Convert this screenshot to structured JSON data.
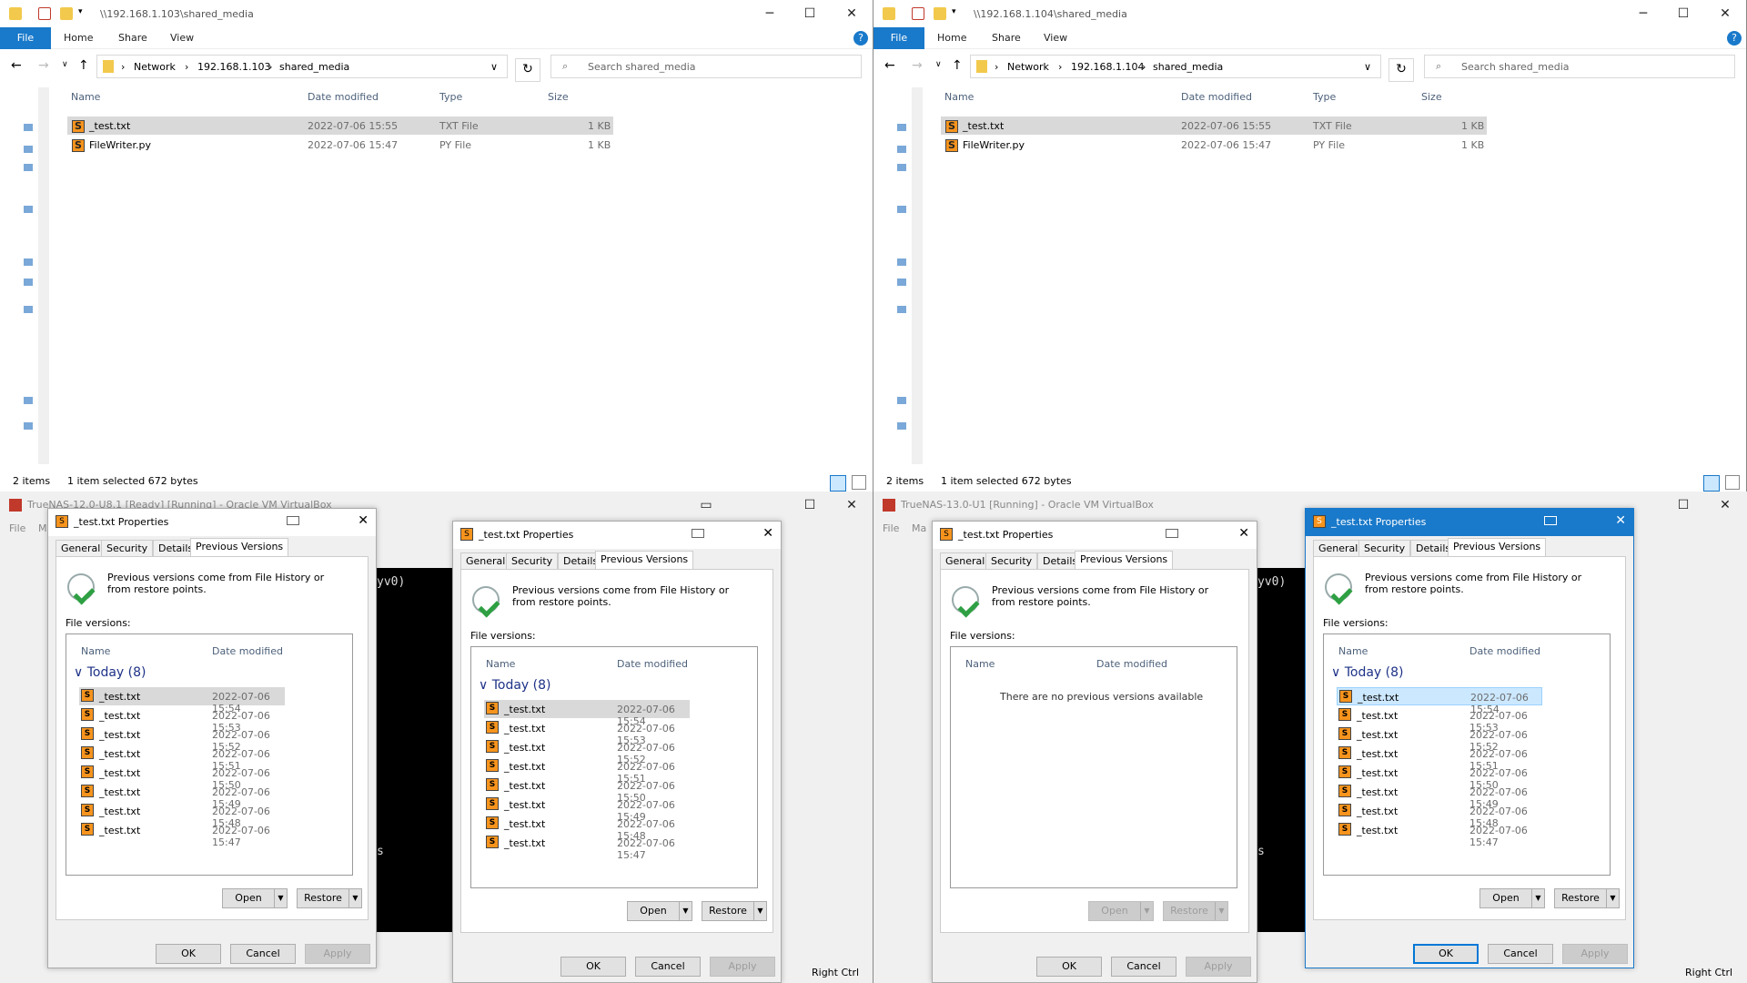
{
  "explorer_left": {
    "title_path": "\\\\192.168.1.103\\shared_media",
    "ribbon": {
      "file": "File",
      "home": "Home",
      "share": "Share",
      "view": "View"
    },
    "breadcrumb": [
      "Network",
      "192.168.1.103",
      "shared_media"
    ],
    "search_placeholder": "Search shared_media",
    "columns": {
      "name": "Name",
      "date": "Date modified",
      "type": "Type",
      "size": "Size"
    },
    "files": [
      {
        "name": "_test.txt",
        "date": "2022-07-06 15:55",
        "type": "TXT File",
        "size": "1 KB"
      },
      {
        "name": "FileWriter.py",
        "date": "2022-07-06 15:47",
        "type": "PY File",
        "size": "1 KB"
      }
    ],
    "status": {
      "count": "2 items",
      "selection": "1 item selected  672 bytes"
    }
  },
  "explorer_right": {
    "title_path": "\\\\192.168.1.104\\shared_media",
    "ribbon": {
      "file": "File",
      "home": "Home",
      "share": "Share",
      "view": "View"
    },
    "breadcrumb": [
      "Network",
      "192.168.1.104",
      "shared_media"
    ],
    "search_placeholder": "Search shared_media",
    "columns": {
      "name": "Name",
      "date": "Date modified",
      "type": "Type",
      "size": "Size"
    },
    "files": [
      {
        "name": "_test.txt",
        "date": "2022-07-06 15:55",
        "type": "TXT File",
        "size": "1 KB"
      },
      {
        "name": "FileWriter.py",
        "date": "2022-07-06 15:47",
        "type": "PY File",
        "size": "1 KB"
      }
    ],
    "status": {
      "count": "2 items",
      "selection": "1 item selected  672 bytes"
    }
  },
  "vbox_left": {
    "title": "TrueNAS-12.0-U8.1 [Ready] [Running] - Oracle VM VirtualBox",
    "menu_file": "File",
    "menu_m": "M",
    "console_a": "yv0)",
    "console_b": "s",
    "right_ctrl": "Right Ctrl"
  },
  "vbox_right": {
    "title": "TrueNAS-13.0-U1 [Running] - Oracle VM VirtualBox",
    "menu_file": "File",
    "menu_m": "Ma",
    "console_a": "yv0)",
    "console_b": "s",
    "right_ctrl": "Right Ctrl"
  },
  "dialog_common": {
    "tabs": [
      "General",
      "Security",
      "Details",
      "Previous Versions"
    ],
    "info": "Previous versions come from File History or from restore points.",
    "file_versions": "File versions:",
    "col_name": "Name",
    "col_date": "Date modified",
    "group": "Today (8)",
    "open": "Open",
    "restore": "Restore",
    "ok": "OK",
    "cancel": "Cancel",
    "apply": "Apply",
    "empty": "There are no previous versions available"
  },
  "dialogs": [
    {
      "title": "_test.txt Properties"
    },
    {
      "title": "_test.txt Properties"
    },
    {
      "title": "_test.txt Properties"
    },
    {
      "title": "_test.txt Properties"
    }
  ],
  "versions": [
    {
      "name": "_test.txt",
      "date": "2022-07-06 15:54"
    },
    {
      "name": "_test.txt",
      "date": "2022-07-06 15:53"
    },
    {
      "name": "_test.txt",
      "date": "2022-07-06 15:52"
    },
    {
      "name": "_test.txt",
      "date": "2022-07-06 15:51"
    },
    {
      "name": "_test.txt",
      "date": "2022-07-06 15:50"
    },
    {
      "name": "_test.txt",
      "date": "2022-07-06 15:49"
    },
    {
      "name": "_test.txt",
      "date": "2022-07-06 15:48"
    },
    {
      "name": "_test.txt",
      "date": "2022-07-06 15:47"
    }
  ],
  "colors": {
    "accent": "#1979ca",
    "selection": "#d9d9d9",
    "file_icon": "#f7941d"
  }
}
